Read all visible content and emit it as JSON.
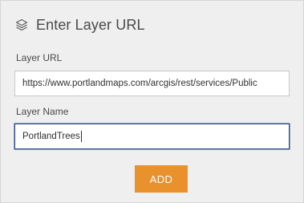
{
  "header": {
    "icon": "layers-icon",
    "title": "Enter Layer URL"
  },
  "form": {
    "url_label": "Layer URL",
    "url_value": "https://www.portlandmaps.com/arcgis/rest/services/Public",
    "name_label": "Layer Name",
    "name_value": "PortlandTrees"
  },
  "actions": {
    "add_label": "ADD"
  },
  "colors": {
    "accent": "#e8912d",
    "focus_border": "#2e4f8a",
    "panel_background": "#efefef"
  }
}
